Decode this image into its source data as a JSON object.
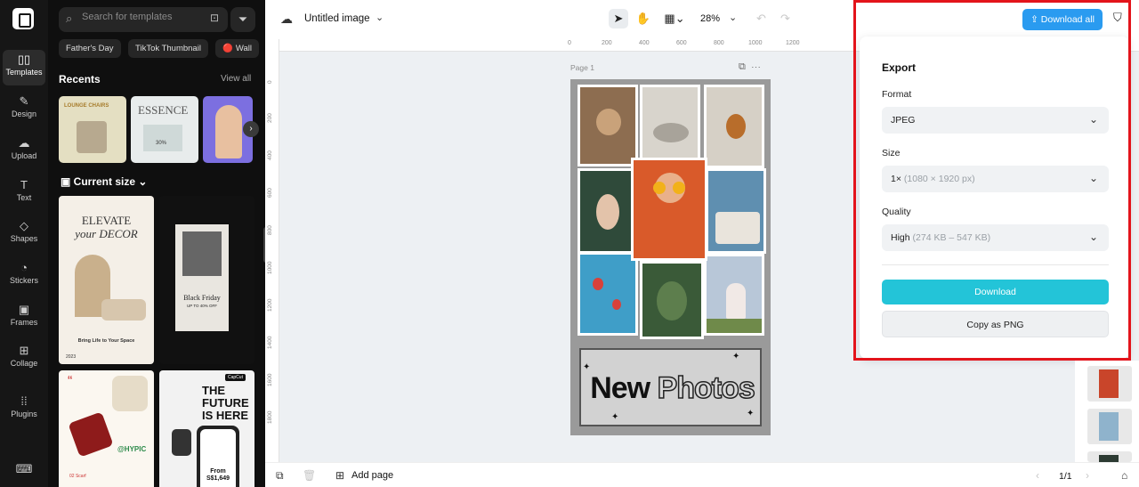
{
  "rail": {
    "items": [
      {
        "label": "Templates",
        "icon": "templates-icon",
        "glyph": "▯▯"
      },
      {
        "label": "Design",
        "icon": "design-icon",
        "glyph": "✎"
      },
      {
        "label": "Upload",
        "icon": "upload-icon",
        "glyph": "☁"
      },
      {
        "label": "Text",
        "icon": "text-icon",
        "glyph": "T"
      },
      {
        "label": "Shapes",
        "icon": "shapes-icon",
        "glyph": "◇"
      },
      {
        "label": "Stickers",
        "icon": "stickers-icon",
        "glyph": "◔"
      },
      {
        "label": "Frames",
        "icon": "frames-icon",
        "glyph": "▣"
      },
      {
        "label": "Collage",
        "icon": "collage-icon",
        "glyph": "⊞"
      },
      {
        "label": "Plugins",
        "icon": "plugins-icon",
        "glyph": "⁞⁞"
      }
    ],
    "keyboard_glyph": "⌨"
  },
  "panel": {
    "search_placeholder": "Search for templates",
    "chips": [
      "Father's Day",
      "TikTok Thumbnail",
      "🔴 Wall"
    ],
    "recents_title": "Recents",
    "view_all": "View all",
    "recent_1_text": "LOUNGE CHAIRS",
    "recent_2_text": "ESSENCE",
    "recent_2_pct": "30%",
    "current_size": "Current size",
    "tpl1": {
      "line1": "ELEVATE",
      "line2": "your DECOR",
      "caption": "Bring Life to Your Space",
      "year": "2023"
    },
    "tpl2": {
      "title": "Black Friday",
      "sub": "UP TO 40% OFF"
    },
    "tpl3": {
      "quote": "“",
      "hypic": "@HYPIC",
      "label": "02 Scarf"
    },
    "tpl4": {
      "headline": "THE FUTURE IS HERE",
      "from": "From S$1,649",
      "brand": "CapCut"
    }
  },
  "topbar": {
    "doc_title": "Untitled image",
    "zoom": "28%",
    "download_all": "Download all"
  },
  "canvas": {
    "page_label": "Page 1",
    "ruler_top": [
      "0",
      "200",
      "400",
      "600",
      "800",
      "1000",
      "1200"
    ],
    "ruler_left": [
      "0",
      "200",
      "400",
      "600",
      "800",
      "1000",
      "1200",
      "1400",
      "1600",
      "1800"
    ],
    "poster_word1": "New",
    "poster_word2": "Photos"
  },
  "export": {
    "title": "Export",
    "format_label": "Format",
    "format_value": "JPEG",
    "size_label": "Size",
    "size_value": "1×",
    "size_detail": "(1080 × 1920 px)",
    "quality_label": "Quality",
    "quality_value": "High",
    "quality_detail": "(274 KB – 547 KB)",
    "download_button": "Download",
    "copy_button": "Copy as PNG"
  },
  "bottombar": {
    "add_page": "Add page",
    "page_count": "1/1"
  },
  "colors": {
    "accent_download": "#23c4d8",
    "download_all": "#2a9bf0",
    "highlight_frame": "#e3141b",
    "rail_bg": "#161616"
  }
}
